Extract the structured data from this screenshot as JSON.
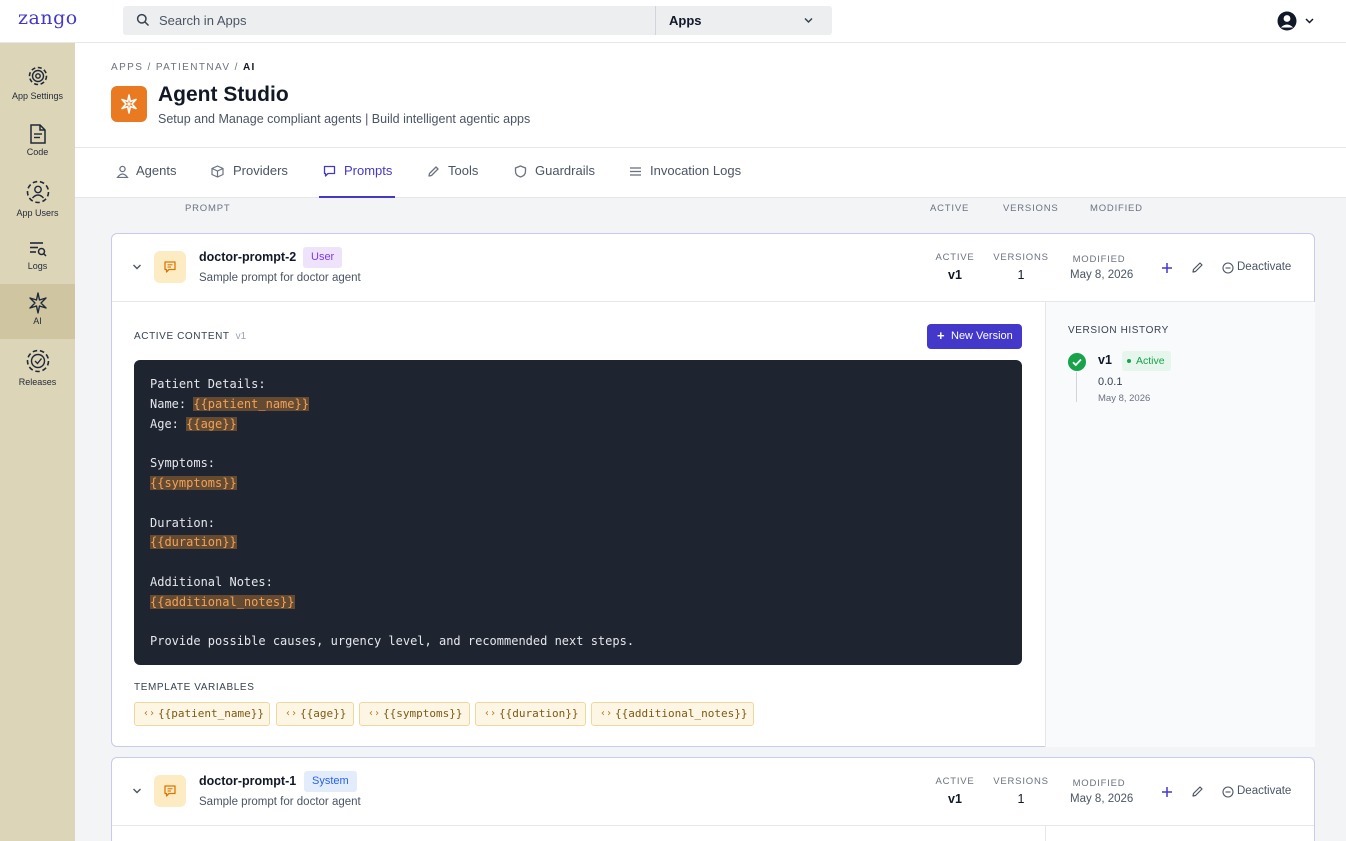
{
  "topbar": {
    "logo": "zango",
    "search_placeholder": "Search in Apps",
    "app_selector": "Apps"
  },
  "sidebar": {
    "items": [
      {
        "label": "App Settings",
        "icon": "gear-icon"
      },
      {
        "label": "Code",
        "icon": "file-code-icon"
      },
      {
        "label": "App Users",
        "icon": "users-gear-icon"
      },
      {
        "label": "Logs",
        "icon": "logs-icon"
      },
      {
        "label": "AI",
        "icon": "ai-sparkle-icon",
        "active": true
      },
      {
        "label": "Releases",
        "icon": "releases-gear-icon"
      }
    ]
  },
  "header": {
    "breadcrumb": [
      "APPS",
      "PATIENTNAV",
      "AI"
    ],
    "title": "Agent Studio",
    "subtitle": "Setup and Manage compliant agents | Build intelligent agentic apps"
  },
  "tabs": [
    {
      "label": "Agents",
      "icon": "person-icon"
    },
    {
      "label": "Providers",
      "icon": "cube-icon"
    },
    {
      "label": "Prompts",
      "icon": "message-icon",
      "active": true
    },
    {
      "label": "Tools",
      "icon": "pencil-icon"
    },
    {
      "label": "Guardrails",
      "icon": "shield-icon"
    },
    {
      "label": "Invocation Logs",
      "icon": "list-icon"
    }
  ],
  "columns": {
    "prompt": "PROMPT",
    "active": "ACTIVE",
    "versions": "VERSIONS",
    "modified": "MODIFIED"
  },
  "prompts": [
    {
      "name": "doctor-prompt-2",
      "type": "User",
      "description": "Sample prompt for doctor agent",
      "active_label": "ACTIVE",
      "active": "v1",
      "versions_label": "VERSIONS",
      "versions": "1",
      "modified_label": "MODIFIED",
      "modified": "May 8, 2026",
      "deactivate": "Deactivate",
      "expanded": true,
      "content_label": "ACTIVE CONTENT",
      "content_version": "v1",
      "new_version": "New Version",
      "content_lines": [
        "Patient Details:",
        "Name: ",
        "{{patient_name}}",
        "Age: ",
        "{{age}}",
        "Symptoms:",
        "{{symptoms}}",
        "Duration:",
        "{{duration}}",
        "Additional Notes:",
        "{{additional_notes}}",
        "Provide possible causes, urgency level, and recommended next steps."
      ],
      "template_variables_label": "TEMPLATE VARIABLES",
      "template_variables": [
        "{{patient_name}}",
        "{{age}}",
        "{{symptoms}}",
        "{{duration}}",
        "{{additional_notes}}"
      ],
      "history_label": "VERSION HISTORY",
      "history": [
        {
          "version": "v1",
          "status": "Active",
          "number": "0.0.1",
          "date": "May 8, 2026"
        }
      ]
    },
    {
      "name": "doctor-prompt-1",
      "type": "System",
      "description": "Sample prompt for doctor agent",
      "active_label": "ACTIVE",
      "active": "v1",
      "versions_label": "VERSIONS",
      "versions": "1",
      "modified_label": "MODIFIED",
      "modified": "May 8, 2026",
      "deactivate": "Deactivate",
      "expanded": false
    }
  ],
  "colors": {
    "accent": "#4338ca",
    "sidebar": "#ddd5b8",
    "app_icon": "#ea7a21",
    "code_bg": "#1e2430",
    "variable": "#f1a25a",
    "success": "#16a34a"
  }
}
